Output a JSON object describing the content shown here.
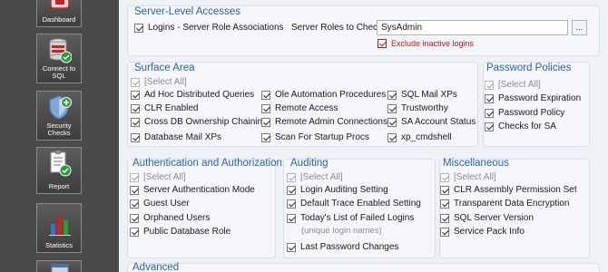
{
  "sidebar": {
    "items": [
      {
        "label": "Dashboard",
        "icon": "dashboard-icon"
      },
      {
        "label": "Connect to SQL",
        "icon": "database-connect-icon"
      },
      {
        "label": "Security Checks",
        "icon": "security-shield-icon"
      },
      {
        "label": "Report",
        "icon": "report-icon"
      },
      {
        "label": "Statistics",
        "icon": "bar-chart-icon"
      }
    ]
  },
  "server_level": {
    "title": "Server-Level Accesses",
    "logins_label": "Logins - Server Role Associations",
    "roles_label": "Server Roles to Check:",
    "roles_value": "SysAdmin",
    "browse_label": "...",
    "exclude_label": "Exclude inactive logins"
  },
  "surface_area": {
    "title": "Surface Area",
    "select_all": "[Select All]",
    "col1": [
      "Ad Hoc Distributed Queries",
      "CLR Enabled",
      "Cross DB Ownership Chaining",
      "Database Mail XPs"
    ],
    "col2": [
      "Ole Automation Procedures",
      "Remote Access",
      "Remote Admin Connections",
      "Scan For Startup Procs"
    ],
    "col3": [
      "SQL Mail XPs",
      "Trustworthy",
      "SA Account Status",
      "xp_cmdshell"
    ]
  },
  "password_policies": {
    "title": "Password Policies",
    "select_all": "[Select All]",
    "items": [
      "Password Expiration",
      "Password Policy",
      "Checks for SA"
    ]
  },
  "auth": {
    "title": "Authentication and Authorization",
    "select_all": "[Select All]",
    "items": [
      "Server Authentication Mode",
      "Guest User",
      "Orphaned Users",
      "Public Database Role"
    ]
  },
  "auditing": {
    "title": "Auditing",
    "select_all": "[Select All]",
    "items": [
      "Login Auditing Setting",
      "Default Trace Enabled Setting",
      "Today's List of Failed Logins"
    ],
    "note": "(unique login names)",
    "last": "Last Password Changes"
  },
  "misc": {
    "title": "Miscellaneous",
    "select_all": "[Select All]",
    "items": [
      "CLR Assembly Permission Set",
      "Transparent Data Encryption",
      "SQL Server Version",
      "Service Pack Info"
    ]
  },
  "advanced": {
    "title": "Advanced"
  },
  "colors": {
    "section_title": "#2b62b0",
    "sidebar_bg": "#4a4a4a",
    "exclude_text": "#c01818",
    "badge_green": "#2e9b3a"
  }
}
